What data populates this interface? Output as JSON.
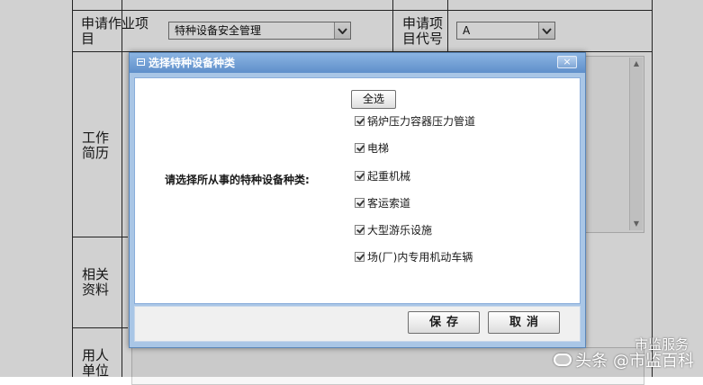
{
  "form": {
    "row_apply_item_label": "申请作业项目",
    "apply_item_value": "特种设备安全管理",
    "row_item_code_label": "申请项目代号",
    "item_code_value": "A",
    "work_history_label": "工作简历",
    "related_docs_label": "相关资料",
    "employer_label": "用人单位"
  },
  "dialog": {
    "title": "选择特种设备种类",
    "close_symbol": "×",
    "prompt": "请选择所从事的特种设备种类:",
    "select_all_label": "全选",
    "options": [
      {
        "label": "锅炉压力容器压力管道",
        "checked": true
      },
      {
        "label": "电梯",
        "checked": true
      },
      {
        "label": "起重机械",
        "checked": true
      },
      {
        "label": "客运索道",
        "checked": true
      },
      {
        "label": "大型游乐设施",
        "checked": true
      },
      {
        "label": "场(厂)内专用机动车辆",
        "checked": true
      }
    ],
    "save_label": "保存",
    "cancel_label": "取消"
  },
  "watermark": {
    "text": "头条 @市监百科",
    "sub": "市监服务"
  }
}
